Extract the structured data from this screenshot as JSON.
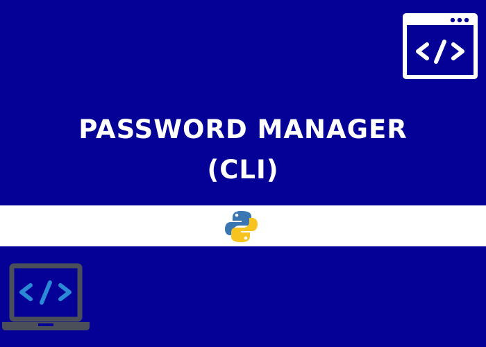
{
  "title": {
    "line1": "PASSWORD MANAGER",
    "line2": "(CLI)"
  },
  "icons": {
    "code_window": "code-window-icon",
    "python": "python-logo-icon",
    "laptop": "laptop-code-icon"
  },
  "colors": {
    "background": "#050096",
    "band": "#ffffff",
    "title_text": "#ffffff",
    "laptop_frame": "#4a4f5a",
    "laptop_code": "#2a8ad6",
    "python_blue": "#3a77b2",
    "python_yellow": "#f7c31f"
  }
}
